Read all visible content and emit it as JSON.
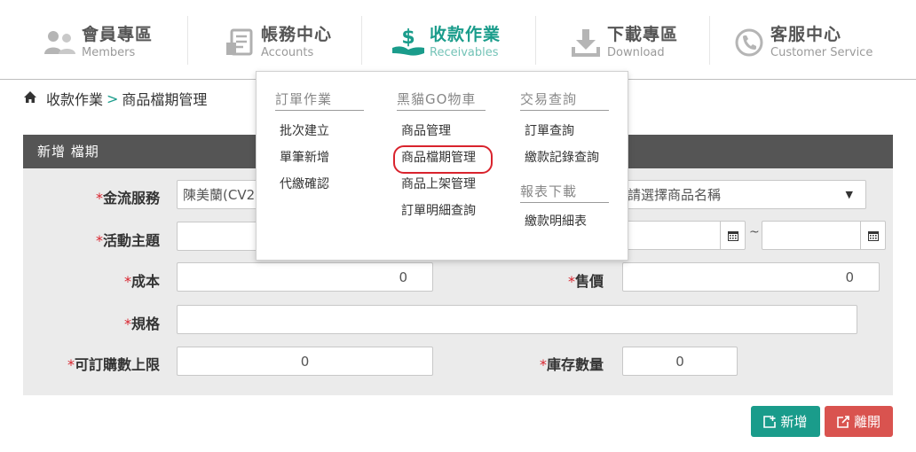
{
  "nav": [
    {
      "zh": "會員專區",
      "en": "Members",
      "icon": "members-icon",
      "active": false
    },
    {
      "zh": "帳務中心",
      "en": "Accounts",
      "icon": "accounts-icon",
      "active": false
    },
    {
      "zh": "收款作業",
      "en": "Receivables",
      "icon": "receivables-icon",
      "active": true
    },
    {
      "zh": "下載專區",
      "en": "Download",
      "icon": "download-icon",
      "active": false
    },
    {
      "zh": "客服中心",
      "en": "Customer Service",
      "icon": "customer-service-icon",
      "active": false
    }
  ],
  "breadcrumb": {
    "section": "收款作業",
    "separator": ">",
    "page": "商品檔期管理"
  },
  "panel": {
    "title": "新增 檔期"
  },
  "form": {
    "required_mark": "*",
    "payment_service_label": "金流服務",
    "payment_service_value": "陳美蘭(CV2",
    "activity_label": "活動主題",
    "product_select_value": "請選擇商品名稱",
    "date_separator": "~",
    "cost_label": "成本",
    "cost_value": "0",
    "price_label": "售價",
    "price_value": "0",
    "spec_label": "規格",
    "limit_label": "可訂購數上限",
    "limit_value": "0",
    "stock_label": "庫存數量",
    "stock_value": "0"
  },
  "menu": {
    "col1": {
      "head": "訂單作業",
      "items": [
        "批次建立",
        "單筆新增",
        "代繳確認"
      ]
    },
    "col2": {
      "head": "黑貓GO物車",
      "items": [
        "商品管理",
        "商品檔期管理",
        "商品上架管理",
        "訂單明細查詢"
      ]
    },
    "col3": {
      "head": "交易查詢",
      "items": [
        "訂單查詢",
        "繳款記錄查詢"
      ],
      "head2": "報表下載",
      "items2": [
        "繳款明細表"
      ]
    }
  },
  "buttons": {
    "add": "新增",
    "leave": "離開"
  },
  "colors": {
    "accent": "#1a9c8b",
    "danger": "#d9534f",
    "required": "#d9232d",
    "panel_header": "#555555"
  }
}
